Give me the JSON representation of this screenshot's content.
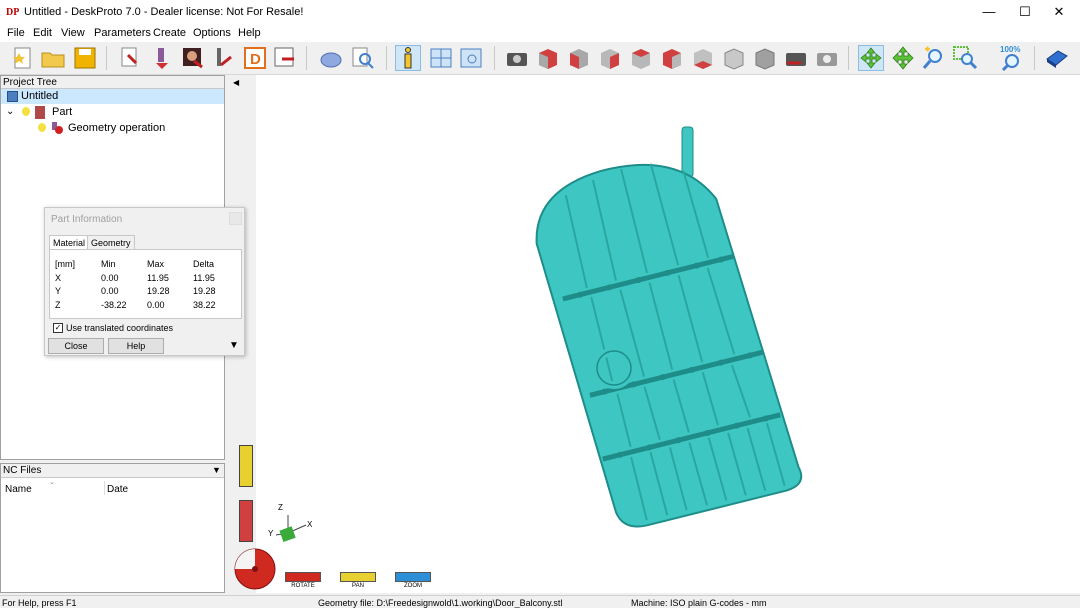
{
  "window": {
    "title": "Untitled - DeskProto 7.0 - Dealer license: Not For Resale!",
    "minimize": "—",
    "maximize": "☐",
    "close": "✕"
  },
  "menu": [
    "File",
    "Edit",
    "View",
    "Parameters",
    "Create",
    "Options",
    "Help"
  ],
  "project_tree": {
    "header": "Project Tree",
    "items": [
      {
        "label": "Untitled"
      },
      {
        "label": "Part"
      },
      {
        "label": "Geometry operation"
      }
    ]
  },
  "nc_files": {
    "header": "NC Files",
    "columns": [
      "Name",
      "Date"
    ]
  },
  "part_info": {
    "title": "Part Information",
    "tabs": [
      "Material",
      "Geometry"
    ],
    "headers": [
      "[mm]",
      "Min",
      "Max",
      "Delta"
    ],
    "rows": [
      [
        "X",
        "0.00",
        "11.95",
        "11.95"
      ],
      [
        "Y",
        "0.00",
        "19.28",
        "19.28"
      ],
      [
        "Z",
        "-38.22",
        "0.00",
        "38.22"
      ]
    ],
    "checkbox_label": "Use translated coordinates",
    "checkbox_checked": true,
    "close_label": "Close",
    "help_label": "Help"
  },
  "axes": {
    "z": "Z",
    "y": "Y",
    "x": "X"
  },
  "view_modes": {
    "rotate": "ROTATE",
    "pan": "PAN",
    "zoom": "ZOOM"
  },
  "toolbar": {
    "zoom_percent": "100%"
  },
  "status": {
    "help": "For Help, press F1",
    "geometry": "Geometry file: D:\\Freedesignwold\\1.working\\Door_Balcony.stl",
    "machine": "Machine: ISO plain G-codes - mm"
  },
  "colors": {
    "model": "#3ec7c2",
    "selection": "#cfe6f7",
    "accent": "#2f8fd6"
  }
}
